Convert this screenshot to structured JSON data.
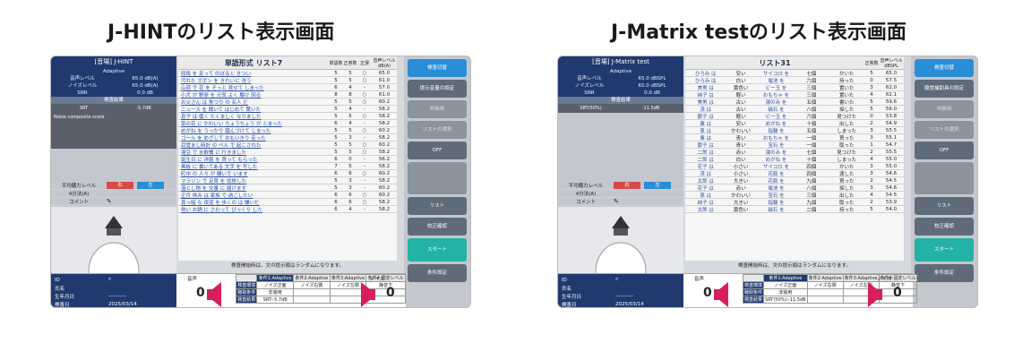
{
  "titles": [
    "J-HINTのリスト表示画面",
    "J-Matrix testのリスト表示画面"
  ],
  "colors": {
    "navy": "#203a70",
    "teal": "#22b2a6",
    "red": "#d84a4a",
    "blue": "#2a8ed6"
  },
  "left": {
    "app_name": "[音場] J-HINT",
    "app_sub": "Adaptive",
    "kvs": [
      [
        "音声レベル",
        "65.0 dB(A)"
      ],
      [
        "ノイズレベル",
        "65.0 dB(A)"
      ],
      [
        "SNR",
        "0.0 dB"
      ]
    ],
    "section": "検査結果",
    "srt_label": "SRT",
    "srt_value": "-5.7dB",
    "score_label": "Noise composite score",
    "level_label": "平均聴力レベル",
    "right_label": "右",
    "left_label": "左",
    "level2": "4分法(A)",
    "comment": "コメント",
    "list_title": "単語形式 リスト7",
    "col_words": "単語数",
    "col_correct": "正答数",
    "col_ok": "正誤",
    "col_level": "音声レベル dB(A)",
    "rows": [
      [
        "段段 を 走って のぼると きつい",
        "5",
        "5",
        "○",
        "65.0"
      ],
      [
        "汚れた ズボン を きれいに 洗う",
        "5",
        "5",
        "○",
        "61.0"
      ],
      [
        "山道 で 花 を そっと 見せて しまった",
        "6",
        "4",
        "-",
        "57.0"
      ],
      [
        "小犬 が 野原 を 元気 よく 駆け 回る",
        "8",
        "8",
        "○",
        "61.0"
      ],
      [
        "お父さん は 魚つり の 名人 だ",
        "5",
        "5",
        "○",
        "60.2"
      ],
      [
        "ニュース を 聞いて はじめて 驚いた",
        "5",
        "4",
        "-",
        "58.2"
      ],
      [
        "息子 は 僕く たくましく なりました",
        "5",
        "5",
        "○",
        "58.2"
      ],
      [
        "菜の花 に かわいい ちょうちょう が とまった",
        "6",
        "4",
        "-",
        "58.2"
      ],
      [
        "めがね を うっかり 踏んづけて しまった",
        "5",
        "5",
        "○",
        "60.2"
      ],
      [
        "ゴール を めざして おもいきり 走った",
        "5",
        "3",
        "-",
        "58.2"
      ],
      [
        "目覚まし時計 の ベル で 起こされた",
        "5",
        "5",
        "○",
        "60.2"
      ],
      [
        "湯豆 で 水飲桶 に 行きました",
        "5",
        "5",
        "○",
        "58.2"
      ],
      [
        "誕生日 に 洋服 を 買って もらった",
        "6",
        "0",
        "-",
        "56.2"
      ],
      [
        "黒板 に 書いてある 文字 を 写した",
        "7",
        "5",
        "-",
        "58.2"
      ],
      [
        "町中 の 人々 が 騒いで います",
        "6",
        "6",
        "○",
        "60.2"
      ],
      [
        "マラソン で 足首 を 捻挫した",
        "5",
        "3",
        "-",
        "58.2"
      ],
      [
        "落とし物 を 交番 に 届けます",
        "5",
        "3",
        "-",
        "60.2"
      ],
      [
        "正月 休み は 家族 で 過ごしたい",
        "6",
        "6",
        "○",
        "60.2"
      ],
      [
        "真っ暗 な 夜道 を 歩くの は 嫌いだ",
        "6",
        "6",
        "○",
        "58.2"
      ],
      [
        "熱い お鍋 に さわって びっくり した",
        "6",
        "4",
        "-",
        "58.2"
      ]
    ],
    "note": "検査開始時は、文の提示順はランダムになります。",
    "buttons": [
      "検査切替",
      "提示音量の設定",
      "非装用",
      "リストの選択",
      "OFF",
      "リスト",
      "校正確認",
      "スタート",
      "条件設定"
    ],
    "id_label": "ID",
    "name_label": "氏名",
    "birth_label": "生年月日",
    "birth_value": "----------",
    "date_label": "検査日",
    "date_value": "2025/03/14",
    "voice_label": "音声",
    "noise_label": "ノイズ",
    "voice_zero": "0",
    "noise_zero": "0",
    "cond_headers": [
      "条件1:Adaptive",
      "条件2:Adaptive",
      "条件3:Adaptive",
      "条件4:固定レベル"
    ],
    "cond_r1": [
      "検査環境",
      "ノイズ正面",
      "ノイズ右側",
      "ノイズ左側",
      "静音下"
    ],
    "cond_r2": [
      "聴取条件",
      "非装用",
      "",
      "",
      ""
    ],
    "cond_r3": [
      "検査結果",
      "SRT:-5.7dB",
      "",
      "",
      ""
    ]
  },
  "right": {
    "app_name": "[音場] J-Matrix test",
    "app_sub": "Adaptive",
    "kvs": [
      [
        "音声レベル",
        "65.0 dBSPL"
      ],
      [
        "ノイズレベル",
        "65.0 dBSPL"
      ],
      [
        "SNR",
        "0.0 dB"
      ]
    ],
    "section": "検査結果",
    "srt_label": "SRT(50%)",
    "srt_value": "-11.5dB",
    "level_label": "平均聴力レベル",
    "right_label": "右",
    "left_label": "左",
    "level2": "4分法(A)",
    "comment": "コメント",
    "list_title": "リスト31",
    "col_correct": "正答数",
    "col_level": "音声レベル dBSPL",
    "rows": [
      [
        "ひろみ は",
        "安い",
        "サイコロ を",
        "七個",
        "かいた",
        "5",
        "65.0"
      ],
      [
        "ひろみ は",
        "白い",
        "電池 を",
        "六個",
        "持った",
        "0",
        "57.5"
      ],
      [
        "美男 は",
        "黄色い",
        "ビー玉 を",
        "三個",
        "置いた",
        "3",
        "62.0"
      ],
      [
        "純子 は",
        "軽い",
        "おもちゃ を",
        "三個",
        "置いた",
        "4",
        "62.1"
      ],
      [
        "美男 は",
        "古い",
        "湯のみ を",
        "五個",
        "書いた",
        "5",
        "59.6"
      ],
      [
        "茂 は",
        "古い",
        "磁石 を",
        "八個",
        "探した",
        "5",
        "56.0"
      ],
      [
        "節子 は",
        "軽い",
        "ビー玉 を",
        "六個",
        "見つけた",
        "0",
        "53.8"
      ],
      [
        "薫 は",
        "安い",
        "めがね を",
        "十個",
        "出した",
        "2",
        "54.9"
      ],
      [
        "恵 は",
        "かわいい",
        "指輪 を",
        "五個",
        "しまった",
        "3",
        "55.5"
      ],
      [
        "薫 は",
        "青い",
        "おもちゃ を",
        "一個",
        "買った",
        "3",
        "55.1"
      ],
      [
        "節子 は",
        "青い",
        "宝石 を",
        "一個",
        "取った",
        "1",
        "54.7"
      ],
      [
        "二郎 は",
        "赤い",
        "湯のみ を",
        "七個",
        "見つけた",
        "2",
        "55.5"
      ],
      [
        "二郎 は",
        "白い",
        "めがね を",
        "十個",
        "しまった",
        "4",
        "55.0"
      ],
      [
        "花子 は",
        "小さい",
        "サイコロ を",
        "四個",
        "かいた",
        "3",
        "55.0"
      ],
      [
        "茂 は",
        "小さい",
        "花瓶 を",
        "四個",
        "渡した",
        "3",
        "54.6"
      ],
      [
        "太郎 は",
        "大きい",
        "花瓶 を",
        "九個",
        "買った",
        "2",
        "54.5"
      ],
      [
        "花子 は",
        "赤い",
        "電池 を",
        "八個",
        "探した",
        "3",
        "54.6"
      ],
      [
        "恵 は",
        "かわいい",
        "宝石 を",
        "三個",
        "出した",
        "4",
        "54.5"
      ],
      [
        "純子 は",
        "大きい",
        "指輪 を",
        "九個",
        "取った",
        "2",
        "53.9"
      ],
      [
        "太郎 は",
        "黄色い",
        "磁石 を",
        "二個",
        "持った",
        "5",
        "54.0"
      ]
    ],
    "note": "検査開始時は、文の提示順はランダムになります。",
    "buttons": [
      "検査切替",
      "聴覚補助具の設定",
      "非装用",
      "リストの選択",
      "OFF",
      "リスト",
      "校正確認",
      "スタート",
      "条件設定"
    ],
    "id_label": "ID",
    "name_label": "氏名",
    "birth_label": "生年月日",
    "birth_value": "----------",
    "date_label": "検査日",
    "date_value": "2025/03/14",
    "voice_label": "音声",
    "noise_label": "ノイズ",
    "voice_zero": "0",
    "noise_zero": "0",
    "cond_headers": [
      "条件1:Adaptive",
      "条件2:Adaptive",
      "条件3:Adaptive",
      "条件4:固定レベル"
    ],
    "cond_r1": [
      "検査環境",
      "ノイズ正面",
      "ノイズ右側",
      "ノイズ左側",
      "静音下"
    ],
    "cond_r2": [
      "聴取条件",
      "非装用",
      "",
      "",
      ""
    ],
    "cond_r3": [
      "検査結果",
      "SRT(50%):-11.5dB",
      "",
      "",
      ""
    ]
  }
}
